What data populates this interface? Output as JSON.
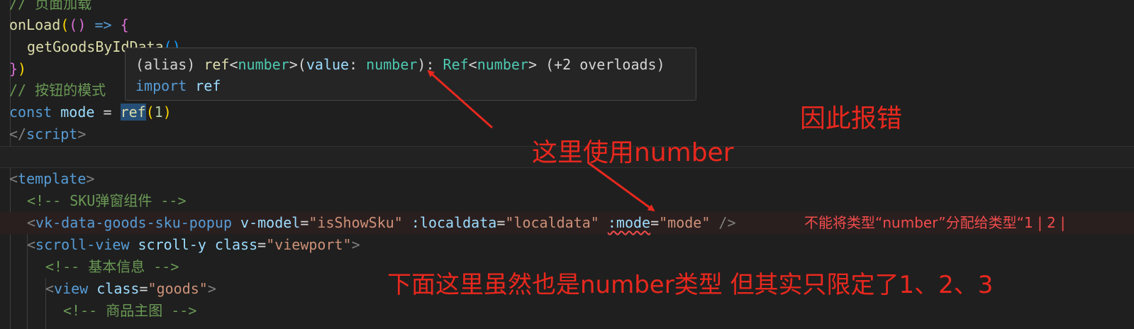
{
  "editor": {
    "lines": {
      "comment_load": "// 页面加载",
      "onload_fn": "onLoad",
      "arrow_op": "=>",
      "get_goods_fn": "getGoodsByIdData",
      "comment_mode": "// 按钮的模式",
      "const_kw": "const",
      "mode_var": "mode",
      "ref_fn": "ref",
      "ref_arg": "1",
      "script_close": "script",
      "template_tag": "template",
      "sku_comment": "<!-- SKU弹窗组件 -->",
      "popup_tag": "vk-data-goods-sku-popup",
      "vmodel_attr": "v-model",
      "vmodel_val": "\"isShowSku\"",
      "localdata_attr": ":localdata",
      "localdata_val": "\"localdata\"",
      "mode_attr": ":mode",
      "mode_val": "\"mode\"",
      "scroll_tag": "scroll-view",
      "scroll_attr1": "scroll-y",
      "class_attr": "class",
      "viewport_val": "\"viewport\"",
      "basic_comment": "<!-- 基本信息 -->",
      "view_tag": "view",
      "goods_val": "\"goods\"",
      "main_img_comment": "<!-- 商品主图 -->"
    },
    "inline_error": "不能将类型“number”分配给类型“1 | 2 |"
  },
  "tooltip": {
    "alias": "(alias)",
    "ref": "ref",
    "number_generic": "number",
    "value_param": "value",
    "number_param": "number",
    "ref_type": "Ref",
    "number_ret": "number",
    "overloads": "(+2 overloads)",
    "import_kw": "import",
    "import_name": "ref"
  },
  "annotations": {
    "error_cause": "因此报错",
    "uses_number": "这里使用number",
    "explanation": "下面这里虽然也是number类型 但其实只限定了1、2、3"
  },
  "colors": {
    "background": "#1f1f1f",
    "annotation_red": "#e8281e",
    "error_red": "#f14c4c"
  }
}
